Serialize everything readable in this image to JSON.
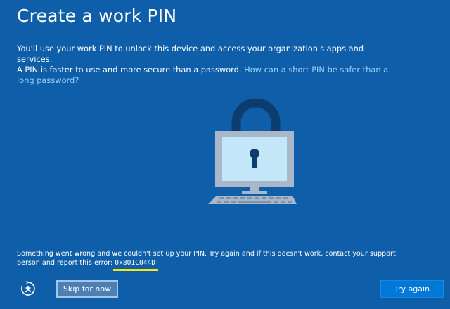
{
  "window": {
    "title": "Create a work PIN"
  },
  "intro": {
    "line1": "You'll use your work PIN to unlock this device and access your organization's apps and services.",
    "line2": "A PIN is faster to use and more secure than a password.",
    "link": "How can a short PIN be safer than a long password?"
  },
  "error": {
    "message": "Something went wrong and we couldn't set up your PIN. Try again and if this doesn't work, contact your support person and report this error:",
    "code": "0x801C044D"
  },
  "footer": {
    "skip_label": "Skip for now",
    "try_label": "Try again"
  },
  "icons": {
    "illustration": "lock-monitor-icon",
    "ease_of_access": "ease-of-access-icon"
  },
  "colors": {
    "background": "#0e5eaa",
    "link": "#9fd1ff",
    "accent_button": "#0078d7",
    "highlight": "#f8e70b",
    "lock_dark": "#0b3e6e",
    "screen": "#c3e6f8"
  }
}
